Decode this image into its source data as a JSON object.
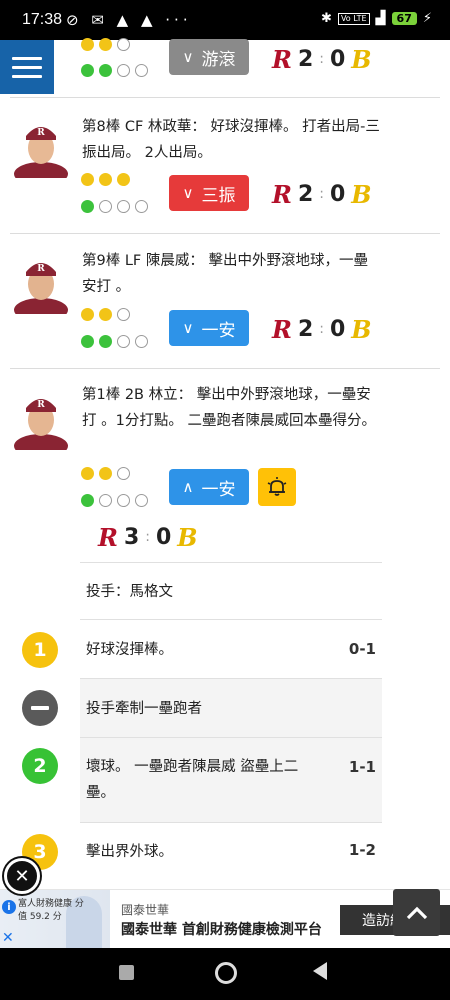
{
  "status_bar": {
    "time": "17:38",
    "battery": "67"
  },
  "top_partial": {
    "play_label": "游滾",
    "score": {
      "home_logo": "R",
      "home": "2",
      "away": "0",
      "away_logo": "B"
    }
  },
  "plays": [
    {
      "description": "第8棒 CF 林政華： 好球沒揮棒。 打者出局-三振出局。 2人出局。",
      "play_label": "三振",
      "score": {
        "home_logo": "R",
        "home": "2",
        "away": "0",
        "away_logo": "B"
      }
    },
    {
      "description": "第9棒 LF 陳晨威： 擊出中外野滾地球，一壘安打 。",
      "play_label": "一安",
      "score": {
        "home_logo": "R",
        "home": "2",
        "away": "0",
        "away_logo": "B"
      }
    },
    {
      "description": "第1棒 2B 林立： 擊出中外野滾地球，一壘安打 。1分打點。 二壘跑者陳晨威回本壘得分。",
      "play_label": "一安",
      "score": {
        "home_logo": "R",
        "home": "3",
        "away": "0",
        "away_logo": "B"
      }
    }
  ],
  "pitcher_label": "投手：馬格文",
  "pitches": [
    {
      "badge": "1",
      "text": "好球沒揮棒。",
      "count": "0-1"
    },
    {
      "badge": "",
      "text": "投手牽制一壘跑者",
      "count": ""
    },
    {
      "badge": "2",
      "text": "壞球。 一壘跑者陳晨威 盜壘上二壘。",
      "count": "1-1"
    },
    {
      "badge": "3",
      "text": "擊出界外球。",
      "count": "1-2"
    }
  ],
  "ad": {
    "small_text": "富人財務健康 分值 59.2 分",
    "brand": "國泰世華",
    "headline": "國泰世華 首創財務健康檢測平台",
    "cta": "造訪網"
  },
  "colors": {
    "menu_blue": "#1763a8",
    "ball_yellow": "#f2c417",
    "strike_green": "#3cc23c",
    "strikeout_red": "#e63a3a",
    "hit_blue": "#2e93e8",
    "groundout_gray": "#8a8a8a",
    "alert_yellow": "#ffc107"
  },
  "icons": [
    "menu-icon",
    "chevron-down-icon",
    "chevron-up-icon",
    "bell-icon",
    "close-icon",
    "chevron-up-scroll-icon"
  ]
}
